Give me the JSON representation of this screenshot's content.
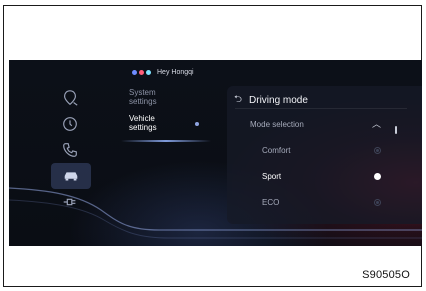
{
  "assistant": {
    "label": "Hey Hongqi",
    "icon": "voice-assistant-icon",
    "dot_colors": [
      "#6f8cff",
      "#ff5f7a",
      "#7fe3ff"
    ]
  },
  "nav_icons": [
    {
      "name": "navigation-pin-icon",
      "active": false
    },
    {
      "name": "clock-icon",
      "active": false
    },
    {
      "name": "phone-icon",
      "active": false
    },
    {
      "name": "car-icon",
      "active": true
    },
    {
      "name": "charging-plug-icon",
      "active": false
    }
  ],
  "menu": {
    "items": [
      {
        "label": "System settings",
        "active": false
      },
      {
        "label": "Vehicle settings",
        "active": true
      }
    ]
  },
  "panel": {
    "title": "Driving mode",
    "back_icon": "back-arrow-icon",
    "section_label": "Mode selection",
    "options": [
      {
        "label": "Comfort",
        "selected": false
      },
      {
        "label": "Sport",
        "selected": true
      },
      {
        "label": "ECO",
        "selected": false
      }
    ]
  },
  "caption": "S90505O",
  "colors": {
    "screen_bg": "#0b0e16",
    "accent_red": "#c81e3c",
    "accent_blue": "#8fa4e0",
    "text_primary": "#ffffff",
    "text_muted": "#a6abbb"
  }
}
